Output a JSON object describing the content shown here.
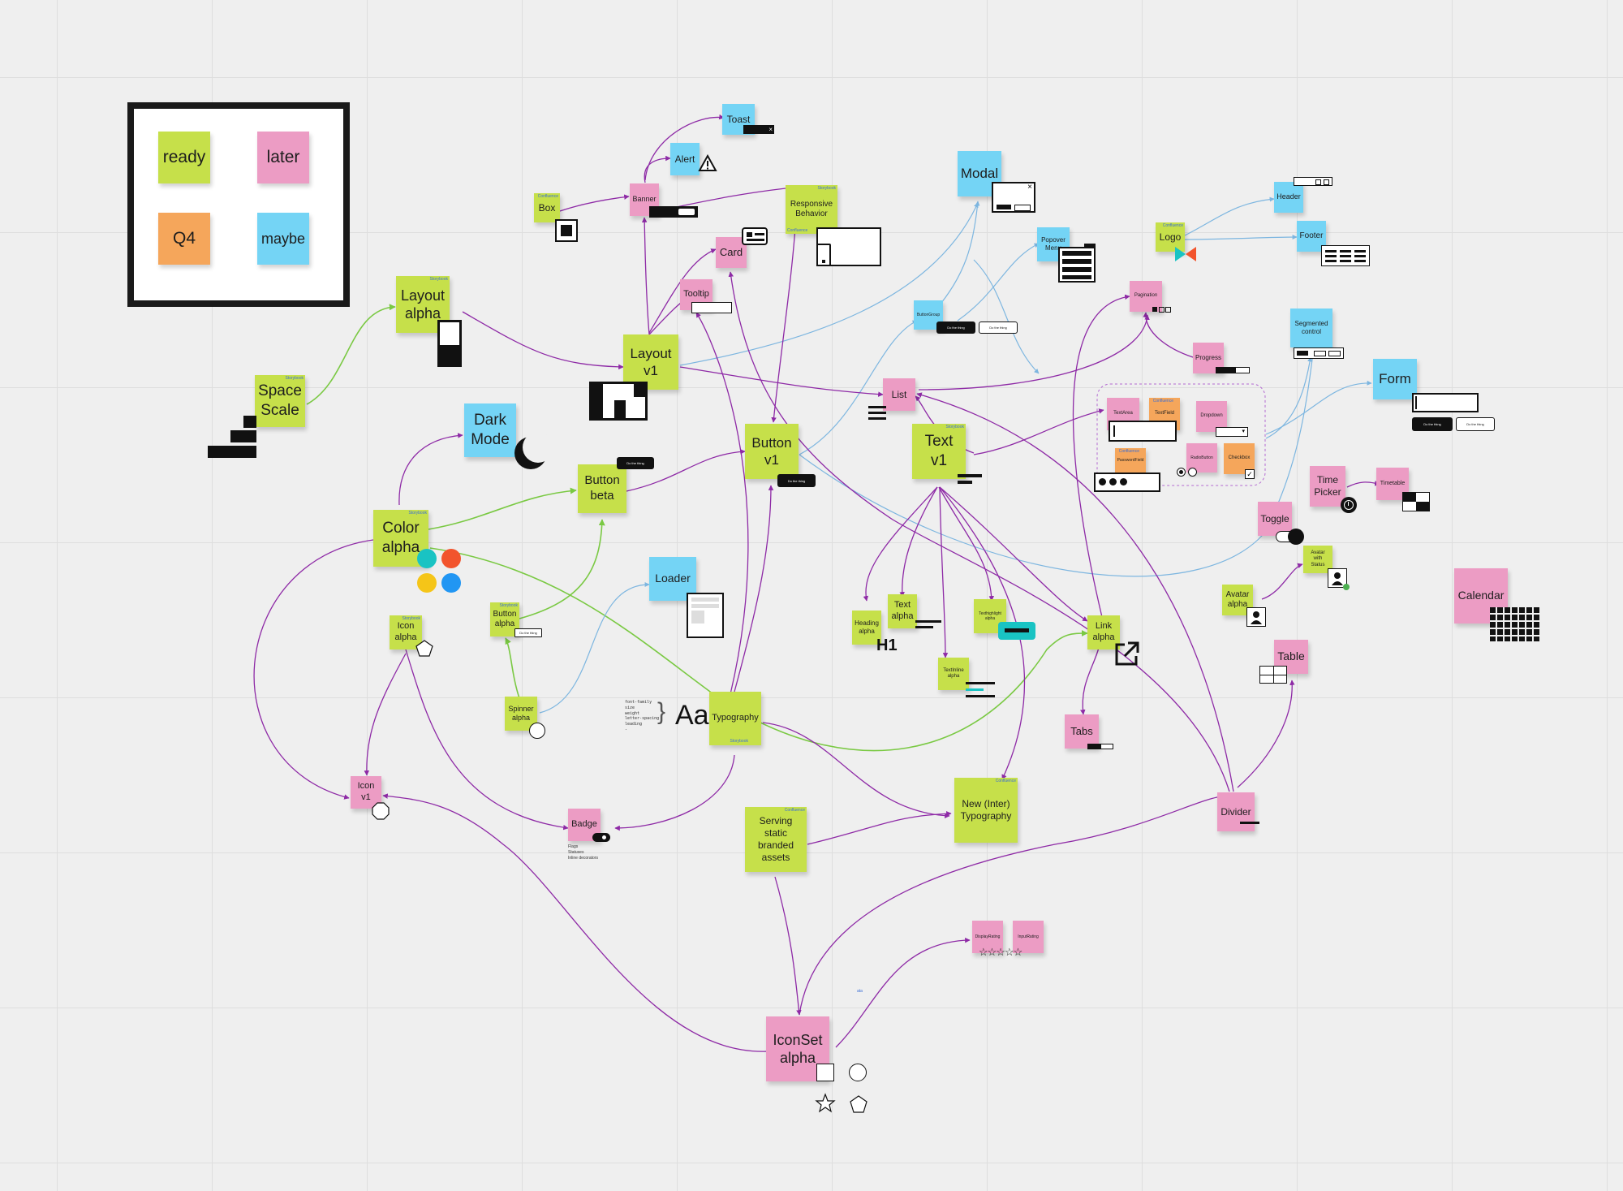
{
  "legend": {
    "ready": "ready",
    "later": "later",
    "q4": "Q4",
    "maybe": "maybe"
  },
  "colors": {
    "ready": "#c6e04a",
    "later": "#ec9cc4",
    "q4": "#f5a65b",
    "maybe": "#74d4f5",
    "purple_edge": "#8e2aa6",
    "green_edge": "#7ac943",
    "blue_edge": "#7db6e0",
    "orange": "#f2542d",
    "yellow": "#f5c518",
    "teal": "#19c3c3",
    "blue": "#2196f3"
  },
  "notes": {
    "space_scale": "Space\nScale",
    "layout_alpha": "Layout\nalpha",
    "layout_v1": "Layout\nv1",
    "dark_mode": "Dark\nMode",
    "color_alpha": "Color\nalpha",
    "button_beta": "Button\nbeta",
    "button_v1": "Button\nv1",
    "text_v1": "Text\nv1",
    "box": "Box",
    "banner": "Banner",
    "alert": "Alert",
    "toast": "Toast",
    "responsive_behavior": "Responsive\nBehavior",
    "card": "Card",
    "tooltip": "Tooltip",
    "modal": "Modal",
    "popover_menu": "Popover\nMenu",
    "button_group": "ButtonGroup",
    "logo": "Logo",
    "header": "Header",
    "footer": "Footer",
    "pagination": "Pagination",
    "progress": "Progress",
    "segmented_control": "Segmented\ncontrol",
    "form": "Form",
    "list": "List",
    "textarea": "TextArea",
    "textfield": "TextField",
    "dropdown": "Dropdown",
    "passwordfield": "PasswordField",
    "radiobutton": "RadioButton",
    "checkbox": "Checkbox",
    "time_picker": "Time\nPicker",
    "timetable": "Timetable",
    "toggle": "Toggle",
    "avatar_with_status": "Avatar\nwith\nStatus",
    "avatar_alpha": "Avatar\nalpha",
    "calendar": "Calendar",
    "table": "Table",
    "divider": "Divider",
    "loader": "Loader",
    "icon_alpha": "Icon\nalpha",
    "button_alpha": "Button\nalpha",
    "spinner_alpha": "Spinner\nalpha",
    "heading_alpha": "Heading\nalpha",
    "text_alpha": "Text\nalpha",
    "texthighlight_alpha": "Texthighlight\nalpha",
    "textinline_alpha": "TextInline\nalpha",
    "link_alpha": "Link\nalpha",
    "tabs": "Tabs",
    "typography": "Typography",
    "icon_v1": "Icon\nv1",
    "badge": "Badge",
    "serving_assets": "Serving\nstatic\nbranded\nassets",
    "new_typography": "New (Inter)\nTypography",
    "iconset_alpha": "IconSet\nalpha",
    "displayrating": "DisplayRating",
    "inputrating": "InputRating"
  },
  "tags": {
    "storybook": "Storybook",
    "confluence": "Confluence"
  },
  "ui_text": {
    "do_the_thing": "Do the thing",
    "font_props": "font-family\nsize\nweight\nletter-spacing\nleading\n-",
    "aa": "Aa",
    "h1": "H1",
    "badge_desc": "Flags\nStatuses\nInline decorators",
    "tiny_label": "ata"
  }
}
